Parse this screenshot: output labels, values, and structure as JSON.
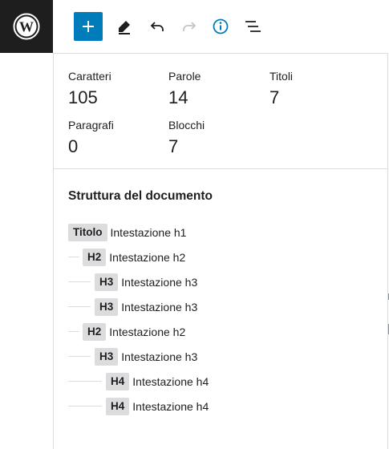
{
  "toolbar": {
    "logo_icon": "wordpress-logo-icon",
    "buttons": [
      {
        "name": "add-block",
        "icon": "plus-icon"
      },
      {
        "name": "tools",
        "icon": "pencil-icon"
      },
      {
        "name": "undo",
        "icon": "undo-icon"
      },
      {
        "name": "redo",
        "icon": "redo-icon"
      },
      {
        "name": "details",
        "icon": "info-icon"
      },
      {
        "name": "outline",
        "icon": "list-view-icon"
      }
    ],
    "accent_color": "#007cba"
  },
  "counts": {
    "characters": {
      "label": "Caratteri",
      "value": "105"
    },
    "words": {
      "label": "Parole",
      "value": "14"
    },
    "headings": {
      "label": "Titoli",
      "value": "7"
    },
    "paragraphs": {
      "label": "Paragrafi",
      "value": "0"
    },
    "blocks": {
      "label": "Blocchi",
      "value": "7"
    }
  },
  "outline": {
    "title": "Struttura del documento",
    "items": [
      {
        "level": "Titolo",
        "text": "Intestazione h1"
      },
      {
        "level": "H2",
        "text": "Intestazione h2"
      },
      {
        "level": "H3",
        "text": "Intestazione h3"
      },
      {
        "level": "H3",
        "text": "Intestazione h3"
      },
      {
        "level": "H2",
        "text": "Intestazione h2"
      },
      {
        "level": "H3",
        "text": "Intestazione h3"
      },
      {
        "level": "H4",
        "text": "Intestazione h4"
      },
      {
        "level": "H4",
        "text": "Intestazione h4"
      }
    ]
  }
}
